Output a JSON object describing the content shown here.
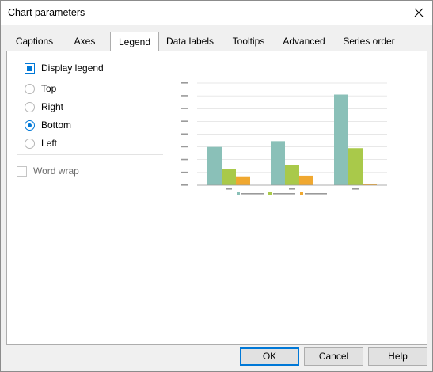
{
  "window": {
    "title": "Chart parameters"
  },
  "tabs": [
    {
      "label": "Captions",
      "active": false
    },
    {
      "label": "Axes",
      "active": false
    },
    {
      "label": "Legend",
      "active": true
    },
    {
      "label": "Data labels",
      "active": false
    },
    {
      "label": "Tooltips",
      "active": false
    },
    {
      "label": "Advanced",
      "active": false
    },
    {
      "label": "Series order",
      "active": false
    }
  ],
  "legend_panel": {
    "display_legend": {
      "label": "Display legend",
      "checked": true
    },
    "position_options": [
      {
        "label": "Top",
        "selected": false
      },
      {
        "label": "Right",
        "selected": false
      },
      {
        "label": "Bottom",
        "selected": true
      },
      {
        "label": "Left",
        "selected": false
      }
    ],
    "word_wrap": {
      "label": "Word wrap",
      "checked": false
    }
  },
  "buttons": {
    "ok": "OK",
    "cancel": "Cancel",
    "help": "Help"
  },
  "chart_data": {
    "type": "bar",
    "categories": [
      "",
      "",
      ""
    ],
    "series": [
      {
        "values": [
          30000,
          34500,
          71000
        ],
        "color": "#8ac0b8"
      },
      {
        "values": [
          12500,
          15500,
          29000
        ],
        "color": "#a9c94a"
      },
      {
        "values": [
          7000,
          7500,
          1200
        ],
        "color": "#f0a830"
      }
    ],
    "ylim": [
      0,
      80000
    ],
    "yticks": [
      0,
      10000,
      20000,
      30000,
      40000,
      50000,
      60000,
      70000,
      80000
    ],
    "legend_position": "bottom",
    "grid": true
  }
}
